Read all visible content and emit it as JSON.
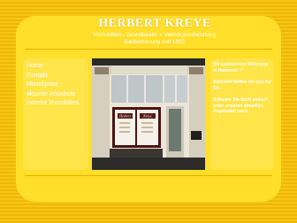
{
  "header": {
    "brand": "HERBERT KREYE",
    "tagline_line1": "Immobilien-, Grundbesitz + Vermögensberatung",
    "tagline_line2": "Baubetreuung seit 1952"
  },
  "nav": {
    "items": [
      {
        "label": "Home"
      },
      {
        "label": "Kontakt"
      },
      {
        "label": "Mietobjekte"
      },
      {
        "label": "aktuelle Angebote"
      },
      {
        "label": "externe Immobilien"
      }
    ]
  },
  "right_panel": {
    "para1": "Sie suchen eine Wohnung in Hannover ?",
    "para2": "Vielleicht hätten wir was für Sie.",
    "para3": "Schauen Sie doch einfach unter unseren aktuellen Angeboten nach."
  },
  "photo": {
    "sign_text": "Herbert Kreye"
  },
  "colors": {
    "background": "#f6c20d",
    "card": "#ffdf2a",
    "panel": "#ffe44a",
    "text": "#ffffff"
  }
}
